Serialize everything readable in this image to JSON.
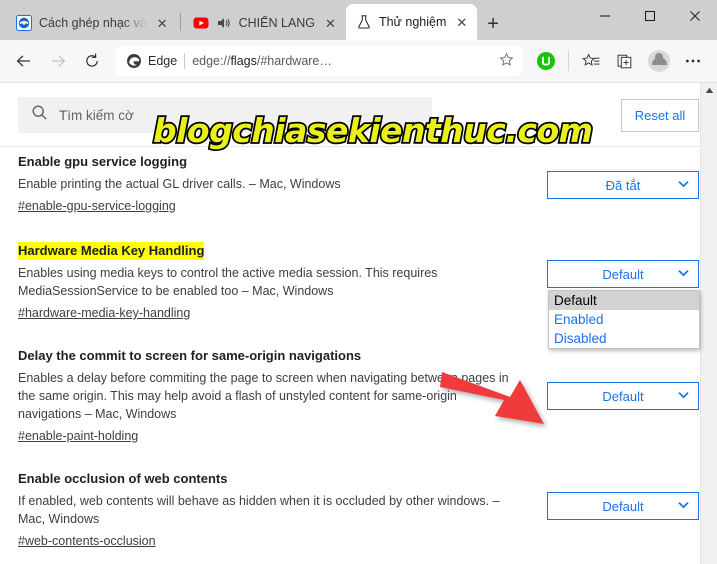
{
  "window": {
    "controls": {
      "minimize": "—",
      "maximize": "□",
      "close": "✕"
    }
  },
  "tabs": [
    {
      "title": "Cách ghép nhạc và",
      "favicon": "camtasia-icon",
      "close": "✕",
      "active": false,
      "muted_icon": ""
    },
    {
      "title": "CHIẾN LANG",
      "favicon": "youtube-icon",
      "close": "✕",
      "active": false,
      "muted_icon": "audio-playing-icon"
    },
    {
      "title": "Thử nghiệm",
      "favicon": "flask-icon",
      "close": "✕",
      "active": true,
      "muted_icon": ""
    }
  ],
  "newtab_label": "+",
  "toolbar": {
    "back": "←",
    "forward": "→",
    "reload": "↻",
    "omnibox": {
      "brand": "Edge",
      "url_prefix": "edge://",
      "url_bold": "flags",
      "url_suffix": "/#hardware…",
      "favorite_icon": "star-outline-icon"
    },
    "extension_icon": "green-extension-icon",
    "favorites_icon": "favorites-icon",
    "collections_icon": "collections-icon",
    "profile_icon": "profile-avatar",
    "settings_icon": "more-options-icon"
  },
  "page": {
    "search": {
      "placeholder": "Tìm kiếm cờ",
      "icon": "search-icon"
    },
    "reset_all_label": "Reset all",
    "flags": [
      {
        "title": "Enable gpu service logging",
        "highlighted": false,
        "description": "Enable printing the actual GL driver calls. – Mac, Windows",
        "link": "#enable-gpu-service-logging",
        "select_value": "Đã tắt",
        "dropdown_open": false,
        "options": []
      },
      {
        "title": "Hardware Media Key Handling",
        "highlighted": true,
        "description": "Enables using media keys to control the active media session. This requires MediaSessionService to be enabled too – Mac, Windows",
        "link": "#hardware-media-key-handling",
        "select_value": "Default",
        "dropdown_open": true,
        "options": [
          "Default",
          "Enabled",
          "Disabled"
        ],
        "selected_option": "Default"
      },
      {
        "title": "Delay the commit to screen for same-origin navigations",
        "highlighted": false,
        "description": "Enables a delay before commiting the page to screen when navigating between pages in the same origin. This may help avoid a flash of unstyled content for same-origin navigations – Mac, Windows",
        "link": "#enable-paint-holding",
        "select_value": "Default",
        "dropdown_open": false,
        "options": []
      },
      {
        "title": "Enable occlusion of web contents",
        "highlighted": false,
        "description": "If enabled, web contents will behave as hidden when it is occluded by other windows. – Mac, Windows",
        "link": "#web-contents-occlusion",
        "select_value": "Default",
        "dropdown_open": false,
        "options": []
      }
    ]
  },
  "annotations": {
    "watermark": "blogchiasekienthuc.com",
    "arrow": "red-arrow-pointing-to-disabled"
  },
  "colors": {
    "accent_blue": "#1a73e8",
    "highlight_yellow": "#ffff00",
    "arrow_red": "#ef3b3b",
    "watermark_yellow": "#e9ef18"
  }
}
